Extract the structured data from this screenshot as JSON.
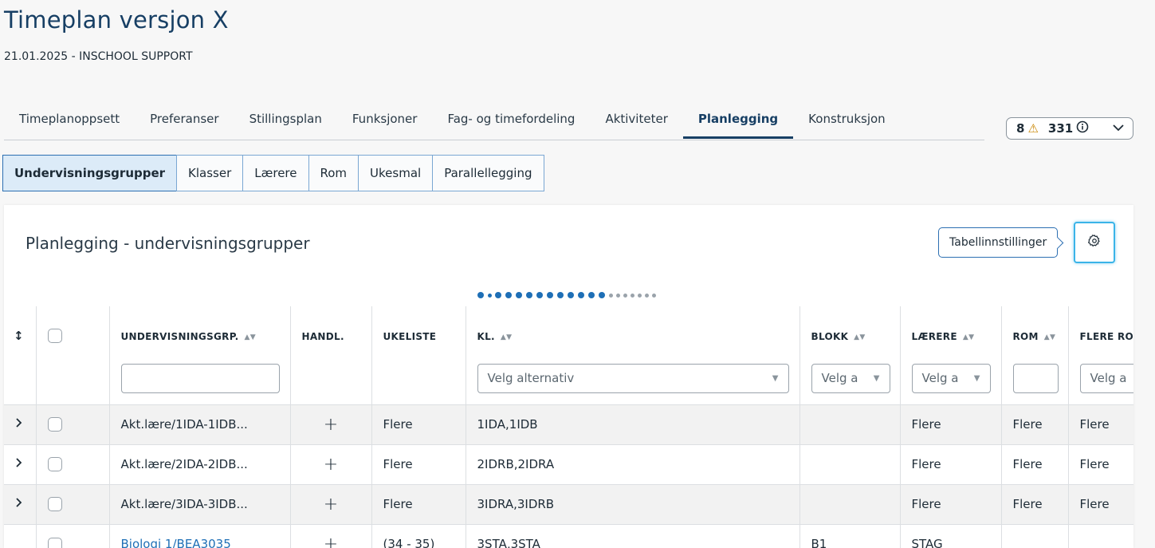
{
  "page": {
    "title": "Timeplan versjon X",
    "subtitle": "21.01.2025 - INSCHOOL SUPPORT"
  },
  "main_tabs": [
    {
      "label": "Timeplanoppsett",
      "active": false
    },
    {
      "label": "Preferanser",
      "active": false
    },
    {
      "label": "Stillingsplan",
      "active": false
    },
    {
      "label": "Funksjoner",
      "active": false
    },
    {
      "label": "Fag- og timefordeling",
      "active": false
    },
    {
      "label": "Aktiviteter",
      "active": false
    },
    {
      "label": "Planlegging",
      "active": true
    },
    {
      "label": "Konstruksjon",
      "active": false
    }
  ],
  "badge": {
    "warnings": "8",
    "info": "331",
    "warning_icon": "warning-triangle-icon",
    "info_icon": "info-circle-icon"
  },
  "sub_tabs": [
    {
      "label": "Undervisningsgrupper",
      "active": true
    },
    {
      "label": "Klasser",
      "active": false
    },
    {
      "label": "Lærere",
      "active": false
    },
    {
      "label": "Rom",
      "active": false
    },
    {
      "label": "Ukesmal",
      "active": false
    },
    {
      "label": "Parallellegging",
      "active": false
    }
  ],
  "card": {
    "title": "Planlegging - undervisningsgrupper",
    "tooltip": "Tabellinnstillinger",
    "settings_icon": "gear-icon"
  },
  "pagination": {
    "active_count": 13,
    "inactive_count": 7
  },
  "table": {
    "columns": [
      {
        "label": "UNDERVISNINGSGRP.",
        "sortable": true,
        "filter": ""
      },
      {
        "label": "HANDL.",
        "sortable": false
      },
      {
        "label": "UKELISTE",
        "sortable": false
      },
      {
        "label": "KL.",
        "sortable": true,
        "filter": "Velg alternativ"
      },
      {
        "label": "BLOKK",
        "sortable": true,
        "filter": "Velg a"
      },
      {
        "label": "LÆRERE",
        "sortable": true,
        "filter": "Velg a"
      },
      {
        "label": "ROM",
        "sortable": true,
        "filter": ""
      },
      {
        "label": "FLERE ROM",
        "sortable": false,
        "filter": "Velg a"
      }
    ],
    "rows": [
      {
        "group": "Akt.lære/1IDA-1IDB...",
        "ukeliste": "Flere",
        "kl": "1IDA,1IDB",
        "blokk": "",
        "laerere": "Flere",
        "rom": "Flere",
        "flere_rom": "Flere"
      },
      {
        "group": "Akt.lære/2IDA-2IDB...",
        "ukeliste": "Flere",
        "kl": "2IDRB,2IDRA",
        "blokk": "",
        "laerere": "Flere",
        "rom": "Flere",
        "flere_rom": "Flere"
      },
      {
        "group": "Akt.lære/3IDA-3IDB...",
        "ukeliste": "Flere",
        "kl": "3IDRA,3IDRB",
        "blokk": "",
        "laerere": "Flere",
        "rom": "Flere",
        "flere_rom": "Flere"
      },
      {
        "group": "Biologi 1/BEA3035",
        "ukeliste": "(34 - 35)",
        "kl": "3STA,3STA",
        "blokk": "B1",
        "laerere": "STAG",
        "rom": "",
        "flere_rom": ""
      }
    ]
  },
  "colors": {
    "primary": "#173f64",
    "accent": "#1e6fb6",
    "focus": "#3ab4e8",
    "warning": "#c98500"
  }
}
